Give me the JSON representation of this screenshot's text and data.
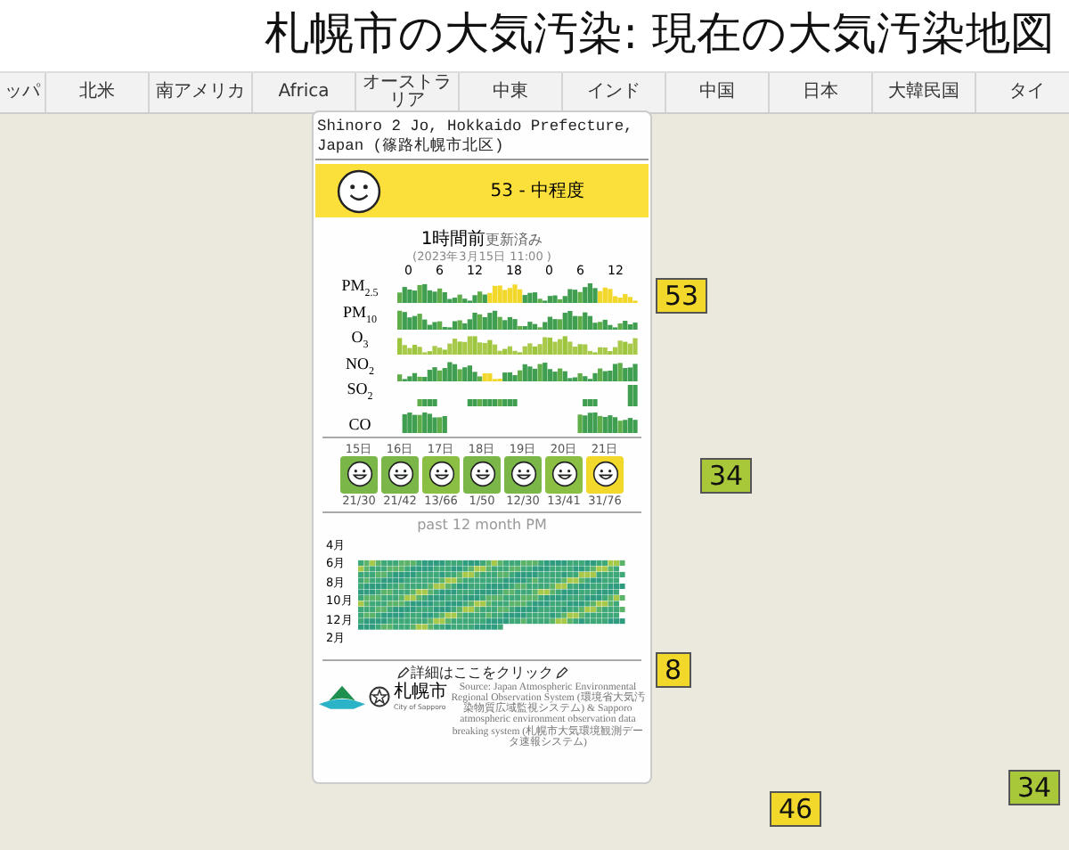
{
  "title": "札幌市の大気汚染: 現在の大気汚染地図",
  "region_tabs": [
    {
      "label": "ッパ",
      "selected": false
    },
    {
      "label": "北米",
      "selected": false
    },
    {
      "label": "南アメリカ",
      "selected": false
    },
    {
      "label": "Africa",
      "selected": false
    },
    {
      "label": "オーストラリア",
      "selected": false
    },
    {
      "label": "中東",
      "selected": false
    },
    {
      "label": "インド",
      "selected": false
    },
    {
      "label": "中国",
      "selected": false
    },
    {
      "label": "日本",
      "selected": false
    },
    {
      "label": "大韓民国",
      "selected": false
    },
    {
      "label": "タイ",
      "selected": false
    }
  ],
  "map": {
    "markers": [
      {
        "value": "53",
        "color": "#f2d82a"
      },
      {
        "value": "34",
        "color": "#a8c83a"
      },
      {
        "value": "8",
        "color": "#f2d82a"
      },
      {
        "value": "46",
        "color": "#f2d82a"
      },
      {
        "value": "34",
        "color": "#a8c83a"
      }
    ]
  },
  "popup": {
    "location": "Shinoro 2 Jo, Hokkaido Prefecture, Japan (篠路札幌市北区)",
    "aqi": {
      "reading": "53 - 中程度",
      "color": "#fbe03c"
    },
    "updated": "1時間前",
    "updated_suffix": "更新済み",
    "timestamp": "(2023年3月15日 11:00 )",
    "hour_ticks": [
      "0",
      "6",
      "12",
      "18",
      "0",
      "6",
      "12"
    ],
    "pollutants": [
      {
        "label": "PM$_{2.5}$"
      },
      {
        "label": "PM$_{10}$"
      },
      {
        "label": "O$_{3}$"
      },
      {
        "label": "NO$_{2}$"
      },
      {
        "label": "SO$_{2}$"
      },
      {
        "label": "CO"
      }
    ],
    "forecast": [
      {
        "day": "15日",
        "range": "21/30",
        "color": "#7ab648"
      },
      {
        "day": "16日",
        "range": "21/42",
        "color": "#7ab648"
      },
      {
        "day": "17日",
        "range": "13/66",
        "color": "#8bbf44"
      },
      {
        "day": "18日",
        "range": "1/50",
        "color": "#7ab648"
      },
      {
        "day": "19日",
        "range": "12/30",
        "color": "#7ab648"
      },
      {
        "day": "20日",
        "range": "13/41",
        "color": "#8bbf44"
      },
      {
        "day": "21日",
        "range": "31/76",
        "color": "#f2d82a"
      }
    ],
    "history_title": "past 12 month PM",
    "month_labels": [
      "4月",
      "6月",
      "8月",
      "10月",
      "12月",
      "2月"
    ],
    "details_link": "詳細はここをクリック",
    "logo_text": "札幌市",
    "logo_subtext": "City of Sapporo",
    "source": "Source: Japan Atmospheric Environmental Regional Observation System (環境省大気汚染物質広域監視システム) & Sapporo atmospheric environment observation data breaking system (札幌市大気環境観測データ速報システム)"
  }
}
